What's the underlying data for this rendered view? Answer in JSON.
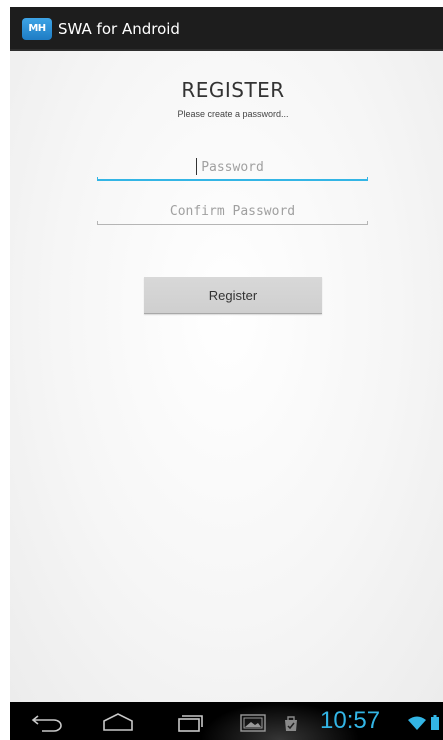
{
  "action_bar": {
    "logo_text": "MH",
    "title": "SWA for Android"
  },
  "form": {
    "title": "REGISTER",
    "subtitle": "Please create a password...",
    "password": {
      "value": "",
      "placeholder": "Password"
    },
    "confirm_password": {
      "value": "",
      "placeholder": "Confirm Password"
    },
    "register_button_label": "Register"
  },
  "status": {
    "time": "10:57"
  },
  "icons": {
    "back": "back-icon",
    "home": "home-icon",
    "recent_apps": "recent-apps-icon",
    "screenshot": "screenshot-icon",
    "notification": "notification-bag-icon",
    "wifi": "wifi-icon",
    "battery": "battery-icon"
  },
  "colors": {
    "accent": "#33b5e5",
    "action_bar": "#1d1d1d",
    "logo": "#2a8fd6",
    "button": "#d4d4d4"
  }
}
